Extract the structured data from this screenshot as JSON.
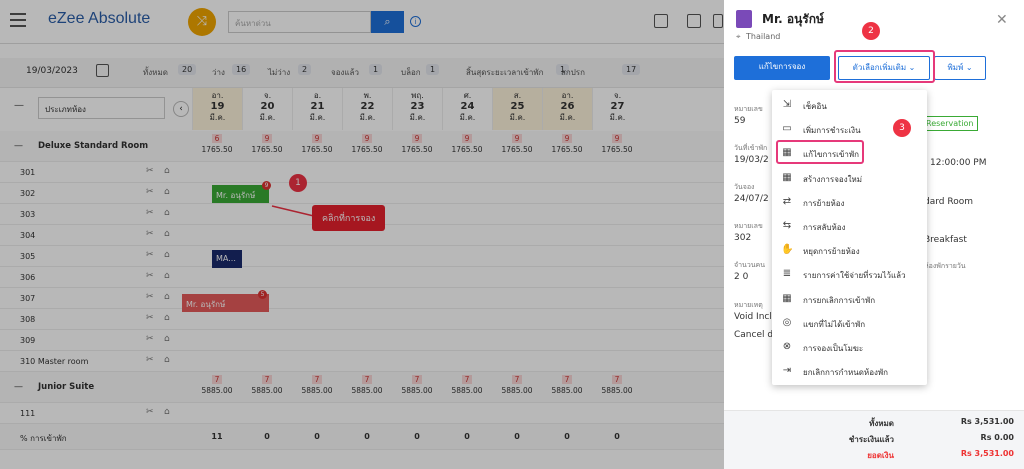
{
  "app": {
    "logo": "eZee Absolute",
    "search_placeholder": "ค้นหาด่วน"
  },
  "toolbar": {
    "date": "19/03/2023",
    "stats": [
      {
        "label": "ทั้งหมด",
        "count": "20"
      },
      {
        "label": "ว่าง",
        "count": "16"
      },
      {
        "label": "ไม่ว่าง",
        "count": "2"
      },
      {
        "label": "จองแล้ว",
        "count": "1"
      },
      {
        "label": "บล็อก",
        "count": "1"
      },
      {
        "label": "สิ้นสุดระยะเวลาเข้าพัก",
        "count": "1"
      },
      {
        "label": "สกปรก",
        "count": "17"
      }
    ]
  },
  "grid": {
    "room_type_placeholder": "ประเภทห้อง",
    "days": [
      {
        "dow": "อา.",
        "day": "19",
        "month": "มี.ค."
      },
      {
        "dow": "จ.",
        "day": "20",
        "month": "มี.ค."
      },
      {
        "dow": "อ.",
        "day": "21",
        "month": "มี.ค."
      },
      {
        "dow": "พ.",
        "day": "22",
        "month": "มี.ค."
      },
      {
        "dow": "พฤ.",
        "day": "23",
        "month": "มี.ค."
      },
      {
        "dow": "ศ.",
        "day": "24",
        "month": "มี.ค."
      },
      {
        "dow": "ส.",
        "day": "25",
        "month": "มี.ค."
      },
      {
        "dow": "อา.",
        "day": "26",
        "month": "มี.ค."
      },
      {
        "dow": "จ.",
        "day": "27",
        "month": "มี.ค."
      }
    ],
    "groups": [
      {
        "name": "Deluxe Standard Room",
        "avail": [
          "6",
          "9",
          "9",
          "9",
          "9",
          "9",
          "9",
          "9",
          "9"
        ],
        "rates": [
          "1765.50",
          "1765.50",
          "1765.50",
          "1765.50",
          "1765.50",
          "1765.50",
          "1765.50",
          "1765.50",
          "1765.50"
        ],
        "rooms": [
          "301",
          "302",
          "303",
          "304",
          "305",
          "306",
          "307",
          "308",
          "309",
          "310 Master room"
        ]
      },
      {
        "name": "Junior Suite",
        "avail": [
          "7",
          "7",
          "7",
          "7",
          "7",
          "7",
          "7",
          "7",
          "7"
        ],
        "rates": [
          "5885.00",
          "5885.00",
          "5885.00",
          "5885.00",
          "5885.00",
          "5885.00",
          "5885.00",
          "5885.00",
          "5885.00"
        ],
        "rooms": [
          "111"
        ]
      }
    ],
    "occupancy_label": "% การเข้าพัก",
    "occupancy": [
      "11",
      "0",
      "0",
      "0",
      "0",
      "0",
      "0",
      "0",
      "0"
    ],
    "bookings": [
      {
        "label": "Mr. อนุรักษ์",
        "color": "#3aaa35",
        "badge": "9"
      },
      {
        "label": "MA...",
        "color": "#1a2a6c"
      },
      {
        "label": "Mr. อนุรักษ์",
        "color": "#e55a5a",
        "badge": "5"
      }
    ]
  },
  "annotations": {
    "c1": "1",
    "c2": "2",
    "c3": "3",
    "tip": "คลิกที่การจอง"
  },
  "panel": {
    "title": "Mr. อนุรักษ์",
    "country": "Thailand",
    "edit_btn": "แก้ไขการจอง",
    "more_btn": "ตัวเลือกเพิ่มเติม",
    "print_btn": "พิมพ์",
    "fields": [
      {
        "label": "หมายเลข",
        "value": "59"
      },
      {
        "label": "วันที่เข้าพัก",
        "value": "19/03/2"
      },
      {
        "label": "วันจอง",
        "value": "24/07/2"
      },
      {
        "label": "หมายเลข",
        "value": "302"
      },
      {
        "label": "จำนวนคน",
        "value": "2   0"
      },
      {
        "label": "หมายเหตุ",
        "value": "Void Incl"
      },
      {
        "label": "",
        "value": "Cancel d"
      }
    ],
    "right_vals": {
      "tag": "Reservation",
      "time": "12:00:00 PM",
      "room": "dard Room",
      "plan": "Breakfast",
      "rate_note": "ห้องพักรายวัน"
    },
    "totals": [
      {
        "label": "ทั้งหมด",
        "value": "Rs 3,531.00"
      },
      {
        "label": "ชำระเงินแล้ว",
        "value": "Rs 0.00"
      },
      {
        "label": "ยอดเงิน",
        "value": "Rs 3,531.00"
      }
    ]
  },
  "menu": [
    {
      "icon": "checkin-icon",
      "glyph": "⇲",
      "label": "เช็คอิน"
    },
    {
      "icon": "payment-icon",
      "glyph": "▭",
      "label": "เพิ่มการชำระเงิน"
    },
    {
      "icon": "edit-stay-icon",
      "glyph": "▦",
      "label": "แก้ไขการเข้าพัก"
    },
    {
      "icon": "new-booking-icon",
      "glyph": "▦",
      "label": "สร้างการจองใหม่"
    },
    {
      "icon": "move-room-icon",
      "glyph": "⇄",
      "label": "การย้ายห้อง"
    },
    {
      "icon": "swap-room-icon",
      "glyph": "⇆",
      "label": "การสลับห้อง"
    },
    {
      "icon": "hand-icon",
      "glyph": "✋",
      "label": "หยุดการย้ายห้อง"
    },
    {
      "icon": "charges-icon",
      "glyph": "≣",
      "label": "รายการค่าใช้จ่ายที่รวมไว้แล้ว"
    },
    {
      "icon": "cancel-stay-icon",
      "glyph": "▦",
      "label": "การยกเลิกการเข้าพัก"
    },
    {
      "icon": "noshow-icon",
      "glyph": "◎",
      "label": "แขกที่ไม่ได้เข้าพัก"
    },
    {
      "icon": "void-icon",
      "glyph": "⊗",
      "label": "การจองเป็นโมฆะ"
    },
    {
      "icon": "unassign-icon",
      "glyph": "⇥",
      "label": "ยกเลิกการกำหนดห้องพัก"
    }
  ]
}
